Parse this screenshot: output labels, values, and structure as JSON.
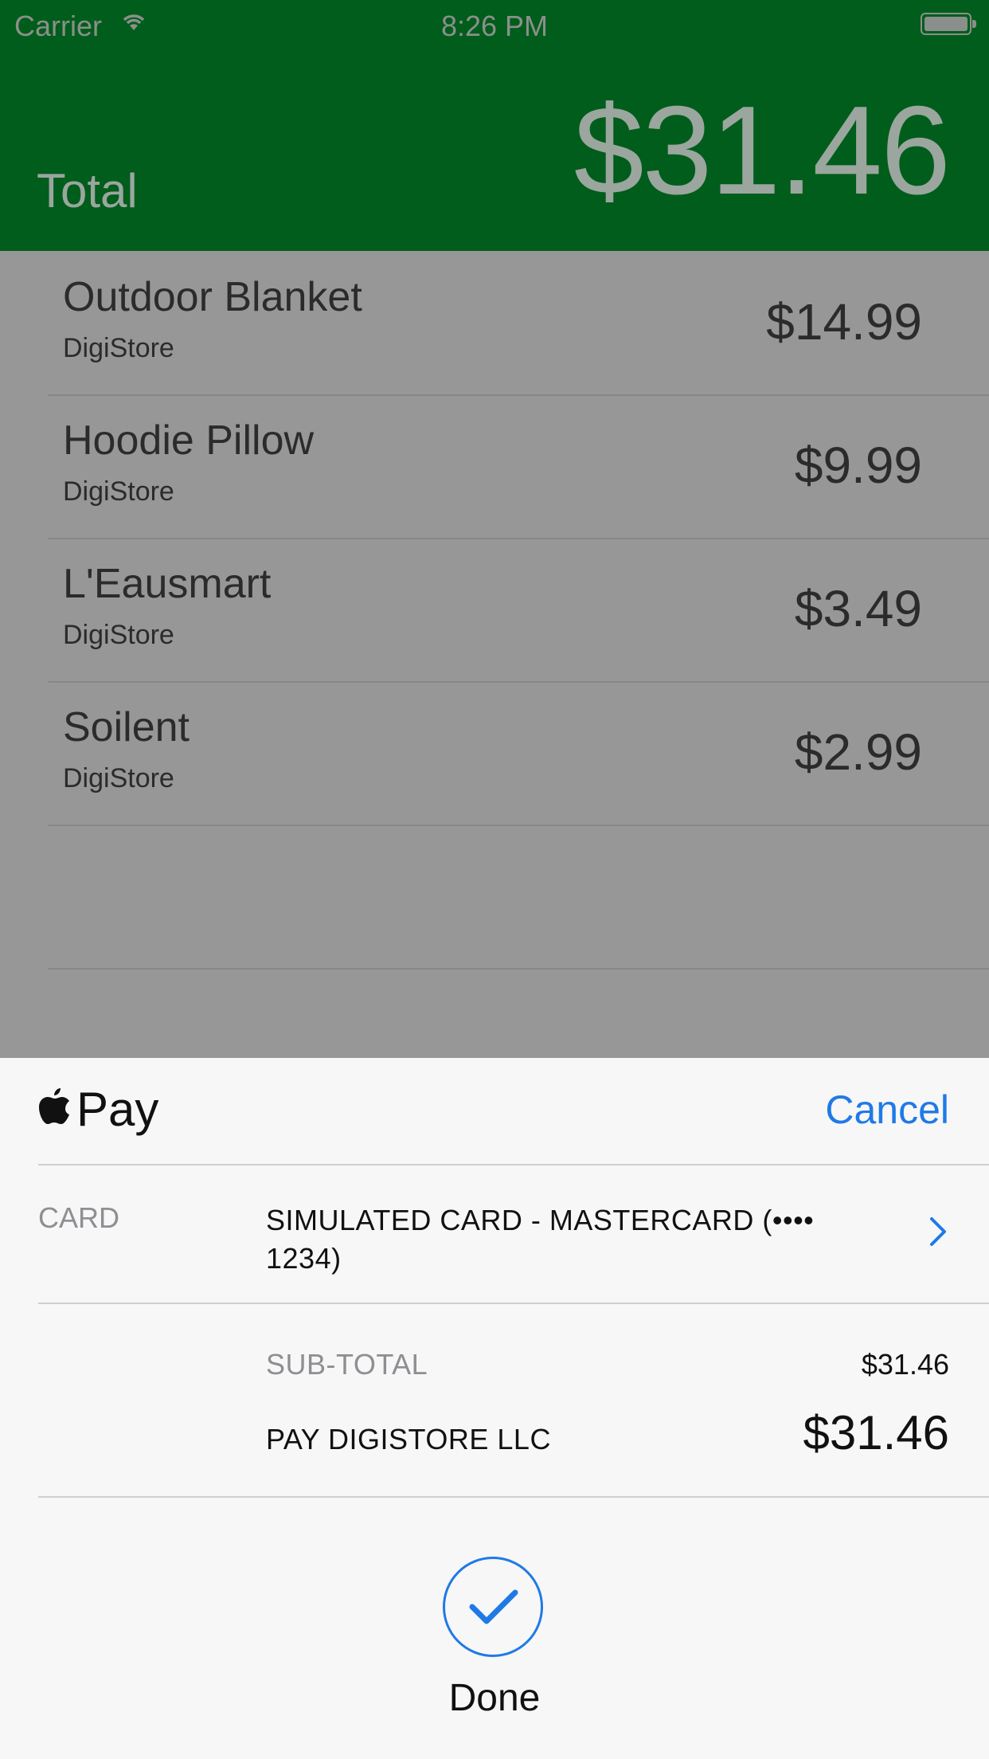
{
  "status_bar": {
    "carrier": "Carrier",
    "time": "8:26 PM"
  },
  "header": {
    "total_label": "Total",
    "total_amount": "$31.46",
    "background_color": "#005d1b"
  },
  "items": [
    {
      "name": "Outdoor Blanket",
      "store": "DigiStore",
      "price": "$14.99"
    },
    {
      "name": "Hoodie Pillow",
      "store": "DigiStore",
      "price": "$9.99"
    },
    {
      "name": "L'Eausmart",
      "store": "DigiStore",
      "price": "$3.49"
    },
    {
      "name": "Soilent",
      "store": "DigiStore",
      "price": "$2.99"
    }
  ],
  "apple_pay": {
    "brand": "Pay",
    "cancel_label": "Cancel",
    "card_label": "CARD",
    "card_value": "SIMULATED CARD - MASTERCARD (•••• 1234)",
    "subtotal_label": "SUB-TOTAL",
    "subtotal_value": "$31.46",
    "pay_label": "PAY DIGISTORE LLC",
    "pay_value": "$31.46",
    "done_label": "Done",
    "accent_color": "#1f7ae6"
  }
}
